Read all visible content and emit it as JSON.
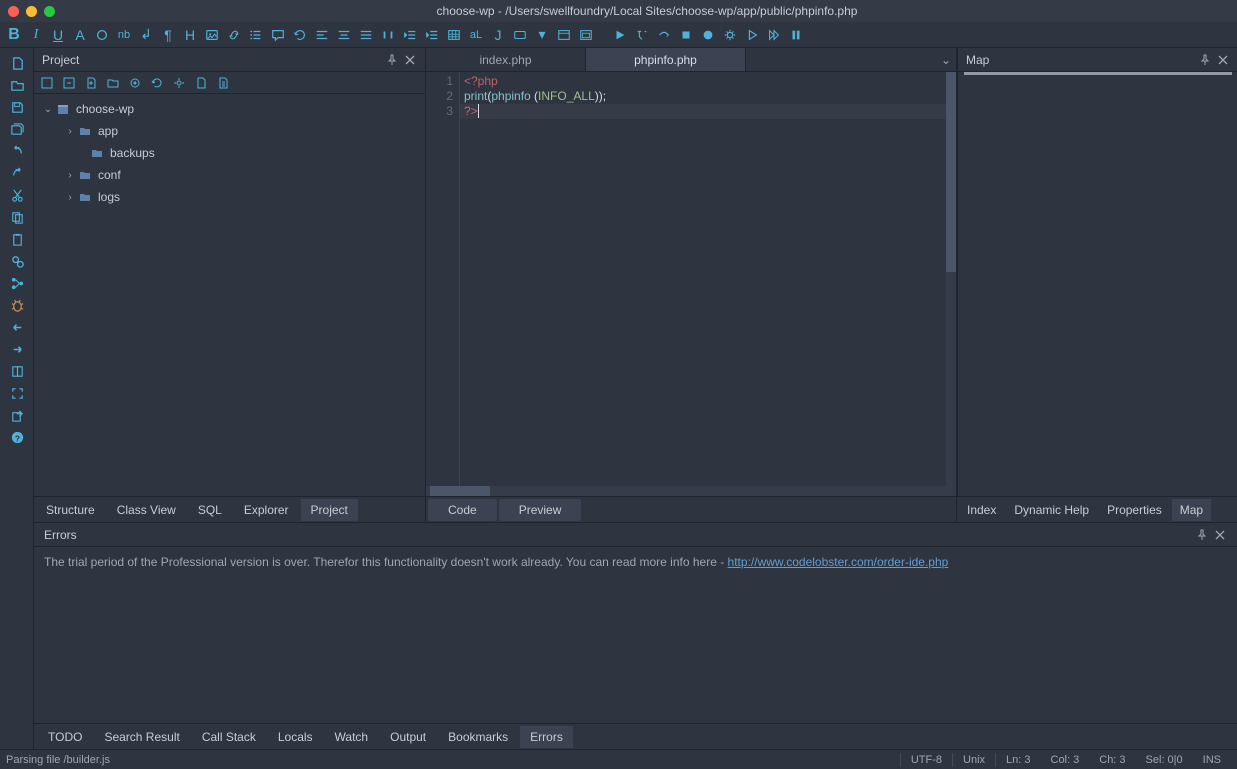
{
  "window": {
    "title": "choose-wp - /Users/swellfoundry/Local Sites/choose-wp/app/public/phpinfo.php"
  },
  "project_panel": {
    "title": "Project"
  },
  "tree": {
    "root": "choose-wp",
    "items": [
      "app",
      "backups",
      "conf",
      "logs"
    ]
  },
  "editor": {
    "tabs": [
      "index.php",
      "phpinfo.php"
    ],
    "active_tab": 1,
    "code": {
      "line1_open": "<?php",
      "line2_func": "print",
      "line2_call": "phpinfo ",
      "line2_const": "INFO_ALL",
      "line2_close": ";",
      "line3_close": "?>"
    },
    "bottom_tabs": [
      "Code",
      "Preview"
    ]
  },
  "map_panel": {
    "title": "Map"
  },
  "left_tabs": [
    "Structure",
    "Class View",
    "SQL",
    "Explorer",
    "Project"
  ],
  "right_tabs": [
    "Index",
    "Dynamic Help",
    "Properties",
    "Map"
  ],
  "errors": {
    "title": "Errors",
    "message_prefix": "The trial period of the Professional version is over. Therefor this functionality doesn't work already. You can read more info here - ",
    "link": "http://www.codelobster.com/order-ide.php"
  },
  "bottom_tabs": [
    "TODO",
    "Search Result",
    "Call Stack",
    "Locals",
    "Watch",
    "Output",
    "Bookmarks",
    "Errors"
  ],
  "status": {
    "parsing": "Parsing file /builder.js",
    "encoding": "UTF-8",
    "eol": "Unix",
    "ln": "Ln: 3",
    "col": "Col: 3",
    "ch": "Ch: 3",
    "sel": "Sel: 0|0",
    "mode": "INS"
  }
}
